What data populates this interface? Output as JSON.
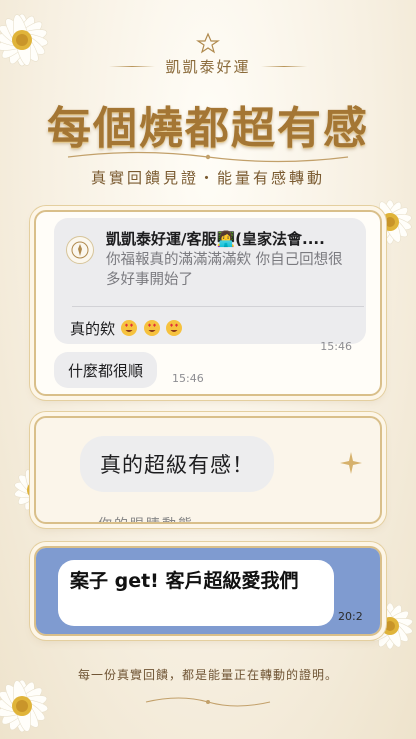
{
  "header": {
    "brand": "凱凱泰好運",
    "headline": "每個燒都超有感",
    "subline": "真實回饋見證・能量有感轉動"
  },
  "card1": {
    "quote_name": "凱凱泰好運/客服👩‍💻(皇家法會....",
    "quote_text": "你福報真的滿滿滿滿欸 你自己回想很多好事開始了",
    "reply_text": "真的欸",
    "reply_emoji_count": 3,
    "reply_time": "15:46",
    "bubble2_text": "什麼都很順",
    "bubble2_time": "15:46"
  },
  "card2": {
    "bubble_text": "真的超級有感！",
    "cut_text": "你的眼睛動態"
  },
  "card3": {
    "bubble_text": "案子 get! 客戶超級愛我們",
    "time": "20:2"
  },
  "footer": {
    "text": "每一份真實回饋，都是能量正在轉動的證明。"
  },
  "colors": {
    "gold": "#a47634",
    "blue_panel": "#7f9bd0"
  }
}
